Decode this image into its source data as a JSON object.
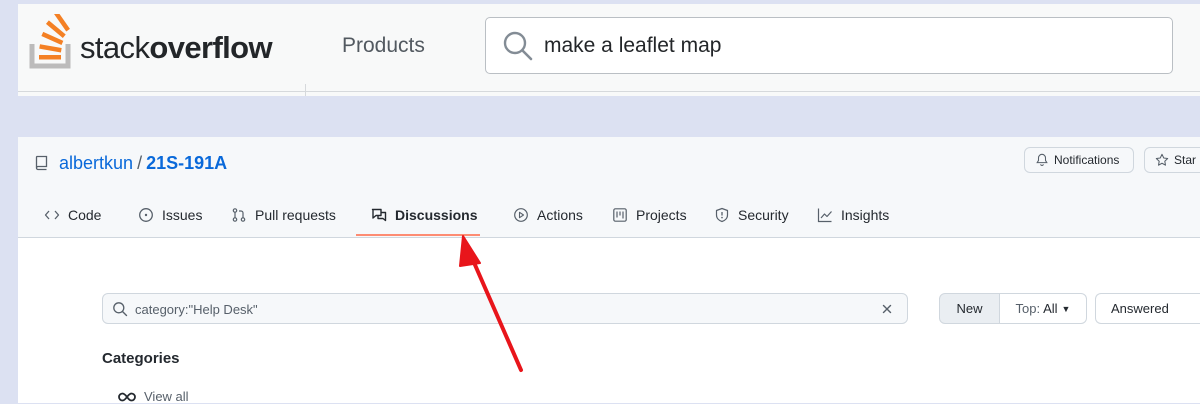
{
  "stackoverflow": {
    "logo_light": "stack",
    "logo_bold": "overflow",
    "products_label": "Products",
    "search_value": "make a leaflet map",
    "search_icon": "search-icon"
  },
  "github": {
    "repo": {
      "owner": "albertkun",
      "separator": "/",
      "name": "21S-191A",
      "icon": "repo-icon"
    },
    "header_buttons": {
      "notifications": "Notifications",
      "star": "Star"
    },
    "tabs": [
      {
        "label": "Code",
        "icon": "code-icon"
      },
      {
        "label": "Issues",
        "icon": "issue-icon"
      },
      {
        "label": "Pull requests",
        "icon": "pull-request-icon"
      },
      {
        "label": "Discussions",
        "icon": "discussions-icon",
        "active": true
      },
      {
        "label": "Actions",
        "icon": "play-icon"
      },
      {
        "label": "Projects",
        "icon": "project-icon"
      },
      {
        "label": "Security",
        "icon": "shield-icon"
      },
      {
        "label": "Insights",
        "icon": "graph-icon"
      }
    ],
    "search": {
      "value": "category:\"Help Desk\""
    },
    "sort": {
      "new_label": "New",
      "top_prefix": "Top:",
      "top_value": "All",
      "answered_label": "Answered"
    },
    "categories": {
      "heading": "Categories",
      "view_all": "View all"
    }
  },
  "colors": {
    "background": "#dce1f2",
    "link_blue": "#0969da",
    "active_underline": "#fd8c73",
    "annotation_arrow": "#e8151b",
    "so_orange": "#f48024"
  }
}
